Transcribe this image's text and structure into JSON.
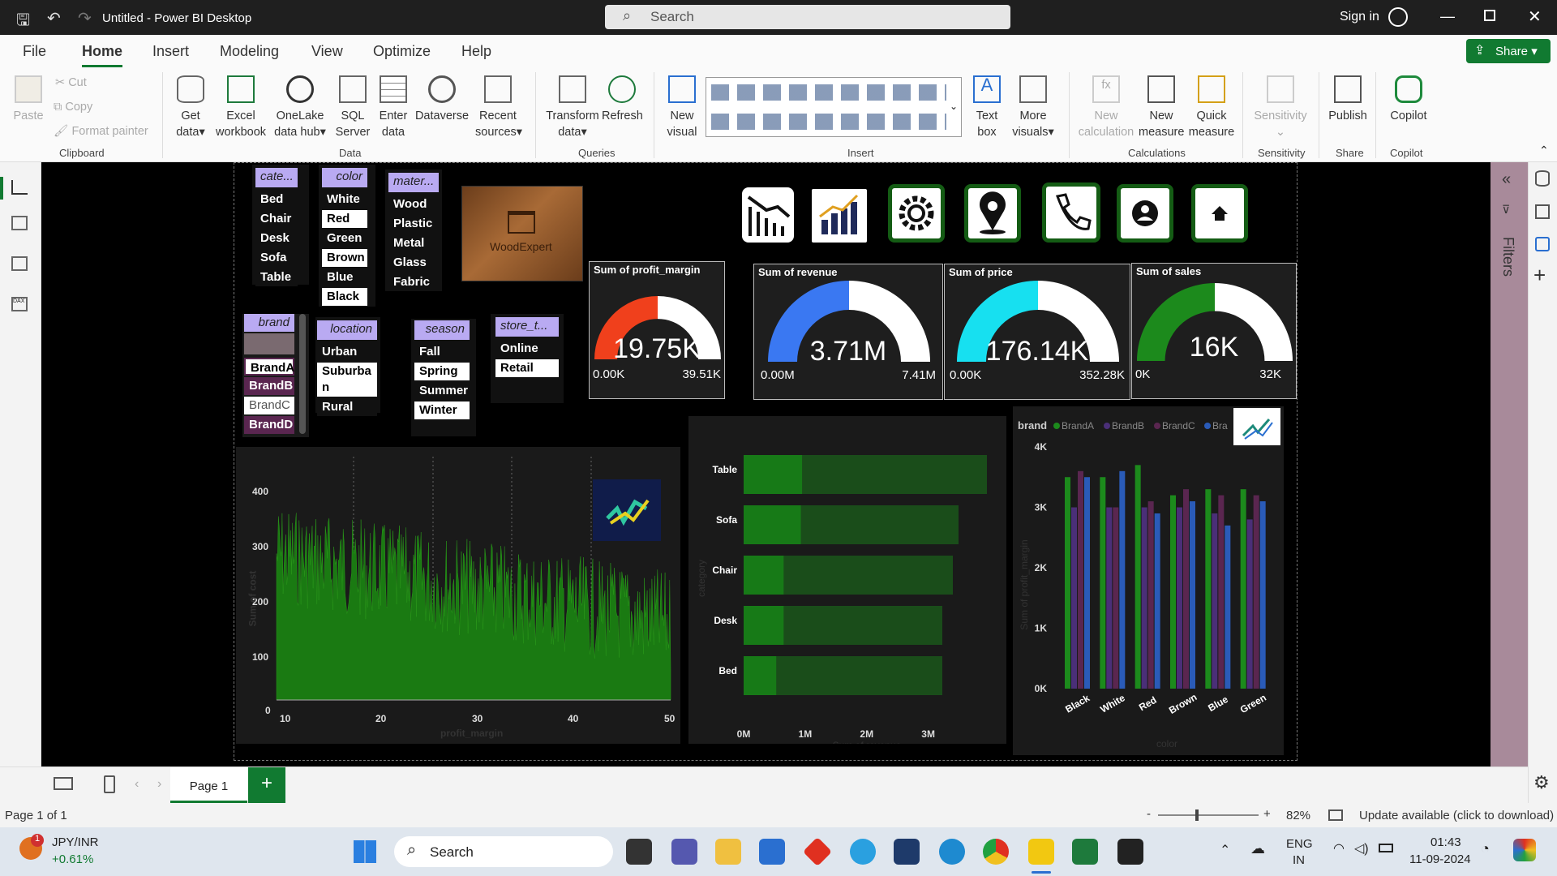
{
  "window": {
    "title": "Untitled - Power BI Desktop",
    "search_placeholder": "Search",
    "signin": "Sign in"
  },
  "menu": {
    "items": [
      "File",
      "Home",
      "Insert",
      "Modeling",
      "View",
      "Optimize",
      "Help"
    ],
    "active": "Home",
    "share": "Share"
  },
  "ribbon": {
    "clipboard": {
      "paste": "Paste",
      "cut": "Cut",
      "copy": "Copy",
      "format_painter": "Format painter",
      "group": "Clipboard"
    },
    "data": {
      "get_data": "Get",
      "get_data2": "data",
      "excel": "Excel",
      "excel2": "workbook",
      "onelake": "OneLake",
      "onelake2": "data hub",
      "sql": "SQL",
      "sql2": "Server",
      "enter": "Enter",
      "enter2": "data",
      "dataverse": "Dataverse",
      "recent": "Recent",
      "recent2": "sources",
      "group": "Data"
    },
    "queries": {
      "transform": "Transform",
      "transform2": "data",
      "refresh": "Refresh",
      "group": "Queries"
    },
    "insert": {
      "new_visual": "New",
      "new_visual2": "visual",
      "text_box": "Text",
      "text_box2": "box",
      "more": "More",
      "more2": "visuals",
      "group": "Insert"
    },
    "calculations": {
      "new_calc": "New",
      "new_calc2": "calculation",
      "new_measure": "New",
      "new_measure2": "measure",
      "quick": "Quick",
      "quick2": "measure",
      "group": "Calculations"
    },
    "sensitivity": {
      "label": "Sensitivity",
      "group": "Sensitivity"
    },
    "share": {
      "publish": "Publish",
      "group": "Share"
    },
    "copilot": {
      "label": "Copilot",
      "group": "Copilot"
    }
  },
  "slicers": {
    "category": {
      "header": "cate...",
      "items": [
        "Bed",
        "Chair",
        "Desk",
        "Sofa",
        "Table"
      ]
    },
    "color": {
      "header": "color",
      "items": [
        "White",
        "Red",
        "Green",
        "Brown",
        "Blue",
        "Black"
      ]
    },
    "material": {
      "header": "mater...",
      "items": [
        "Wood",
        "Plastic",
        "Metal",
        "Glass",
        "Fabric"
      ]
    },
    "brand": {
      "header": "brand",
      "items": [
        "BrandA",
        "BrandB",
        "BrandC",
        "BrandD"
      ]
    },
    "location": {
      "header": "location",
      "items": [
        "Urban",
        "Suburba",
        "n",
        "Rural"
      ]
    },
    "season": {
      "header": "season",
      "items": [
        "Fall",
        "Spring",
        "Summer",
        "Winter"
      ]
    },
    "store": {
      "header": "store_t...",
      "items": [
        "Online",
        "Retail"
      ]
    }
  },
  "logo": {
    "text": "WoodExpert"
  },
  "gauges": [
    {
      "title": "Sum of profit_margin",
      "value": "19.75K",
      "min": "0.00K",
      "max": "39.51K",
      "fraction": 0.5,
      "color": "#f0401c"
    },
    {
      "title": "Sum of revenue",
      "value": "3.71M",
      "min": "0.00M",
      "max": "7.41M",
      "fraction": 0.5,
      "color": "#3a78f2"
    },
    {
      "title": "Sum of price",
      "value": "176.14K",
      "min": "0.00K",
      "max": "352.28K",
      "fraction": 0.5,
      "color": "#17e0f0"
    },
    {
      "title": "Sum of sales",
      "value": "16K",
      "min": "0K",
      "max": "32K",
      "fraction": 0.5,
      "color": "#1c8a1c"
    }
  ],
  "area_chart": {
    "x_ticks": [
      "10",
      "20",
      "30",
      "40",
      "50"
    ],
    "y_ticks": [
      "0",
      "100",
      "200",
      "300",
      "400"
    ],
    "xlabel": "profit_margin",
    "ylabel": "Sum of cost"
  },
  "chart_data": [
    {
      "type": "bar",
      "categories": [
        "Table",
        "Sofa",
        "Chair",
        "Desk",
        "Bed"
      ],
      "values": [
        0.95,
        0.93,
        0.65,
        0.65,
        0.53
      ],
      "xlim": [
        0,
        3.4
      ],
      "x_ticks": [
        "0M",
        "1M",
        "2M",
        "3M"
      ],
      "ylabel": "category",
      "xlabel": "Sum of revenue",
      "units": "M"
    },
    {
      "type": "bar",
      "categories": [
        "Black",
        "White",
        "Red",
        "Brown",
        "Blue",
        "Green"
      ],
      "series": [
        {
          "name": "BrandA",
          "values": [
            3.5,
            3.5,
            3.7,
            3.2,
            3.3,
            3.3
          ]
        },
        {
          "name": "BrandB",
          "values": [
            3.0,
            3.0,
            3.0,
            3.0,
            2.9,
            2.8
          ]
        },
        {
          "name": "BrandC",
          "values": [
            3.6,
            3.0,
            3.1,
            3.3,
            3.2,
            3.2
          ]
        },
        {
          "name": "BrandD",
          "values": [
            3.5,
            3.6,
            2.9,
            3.1,
            2.7,
            3.1
          ]
        }
      ],
      "ylim": [
        0,
        4
      ],
      "y_ticks": [
        "0K",
        "1K",
        "2K",
        "3K",
        "4K"
      ],
      "legend_title": "brand",
      "legend_items": [
        "BrandA",
        "BrandB",
        "BrandC",
        "Bra"
      ],
      "ylabel": "Sum of profit_margin",
      "xlabel": "color"
    }
  ],
  "pagebar": {
    "page": "Page 1"
  },
  "status": {
    "page_info": "Page 1 of 1",
    "zoom": "82%",
    "update": "Update available (click to download)"
  },
  "filters": {
    "label": "Filters"
  },
  "taskbar": {
    "ticker": "JPY/INR",
    "change": "+0.61%",
    "badge": "1",
    "search": "Search",
    "lang1": "ENG",
    "lang2": "IN",
    "time": "01:43",
    "date": "11-09-2024"
  },
  "colors": {
    "accent_green": "#117a31",
    "brandA": "#1c8a1c",
    "brandB": "#4a2f78",
    "brandC": "#5a2650",
    "brandD": "#2a5bb8"
  }
}
